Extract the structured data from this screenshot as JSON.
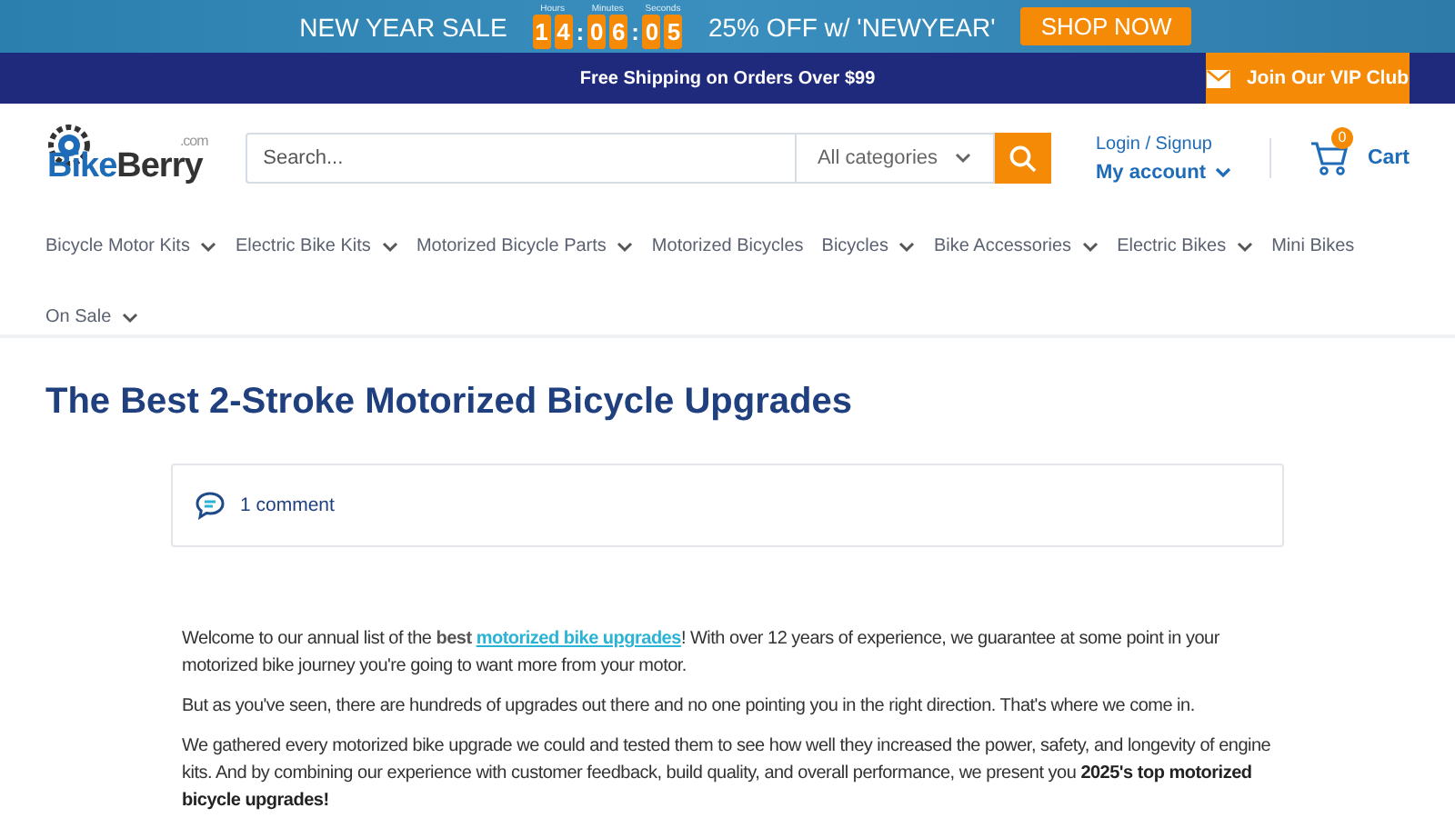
{
  "promo_banner": {
    "title": "NEW YEAR SALE",
    "countdown": [
      {
        "label": "Hours",
        "digits": [
          "1",
          "4"
        ]
      },
      {
        "label": "Minutes",
        "digits": [
          "0",
          "6"
        ]
      },
      {
        "label": "Seconds",
        "digits": [
          "0",
          "5"
        ]
      }
    ],
    "separator": ":",
    "offer": "25% OFF w/ 'NEWYEAR'",
    "button": "SHOP NOW"
  },
  "announcement_bar": {
    "text": "Free Shipping on Orders Over $99",
    "vip_button": "Join Our VIP Club"
  },
  "header": {
    "logo": {
      "brand_first": "Bike",
      "brand_second": "Berry",
      "suffix": ".com"
    },
    "search": {
      "placeholder": "Search...",
      "category": "All categories"
    },
    "account": {
      "login": "Login / Signup",
      "my_account": "My account"
    },
    "cart": {
      "count": "0",
      "label": "Cart"
    }
  },
  "nav": [
    {
      "label": "Bicycle Motor Kits",
      "dropdown": true
    },
    {
      "label": "Electric Bike Kits",
      "dropdown": true
    },
    {
      "label": "Motorized Bicycle Parts",
      "dropdown": true
    },
    {
      "label": "Motorized Bicycles",
      "dropdown": false
    },
    {
      "label": "Bicycles",
      "dropdown": true
    },
    {
      "label": "Bike Accessories",
      "dropdown": true
    },
    {
      "label": "Electric Bikes",
      "dropdown": true
    },
    {
      "label": "Mini Bikes",
      "dropdown": false
    },
    {
      "label": "On Sale",
      "dropdown": true
    }
  ],
  "article": {
    "title": "The Best 2-Stroke Motorized Bicycle Upgrades",
    "comments": "1 comment",
    "paragraphs": [
      [
        {
          "kind": "text",
          "text": "Welcome to our annual list of the "
        },
        {
          "kind": "bold",
          "text": "best "
        },
        {
          "kind": "link",
          "text": "motorized bike upgrades"
        },
        {
          "kind": "text",
          "text": "! With over 12 years of experience, we guarantee at some point in your motorized bike journey you're going to want more from your motor."
        }
      ],
      [
        {
          "kind": "text",
          "text": "But as you've seen, there are hundreds of upgrades out there and no one pointing you in the right direction. That's where we come in."
        }
      ],
      [
        {
          "kind": "text",
          "text": "We gathered every motorized bike upgrade we could and tested them to see how well they increased the power, safety, and longevity of engine kits. And by combining our experience with customer feedback, build quality, and overall performance, we present you "
        },
        {
          "kind": "bold",
          "text": "2025's top motorized bicycle upgrades!"
        }
      ]
    ]
  }
}
